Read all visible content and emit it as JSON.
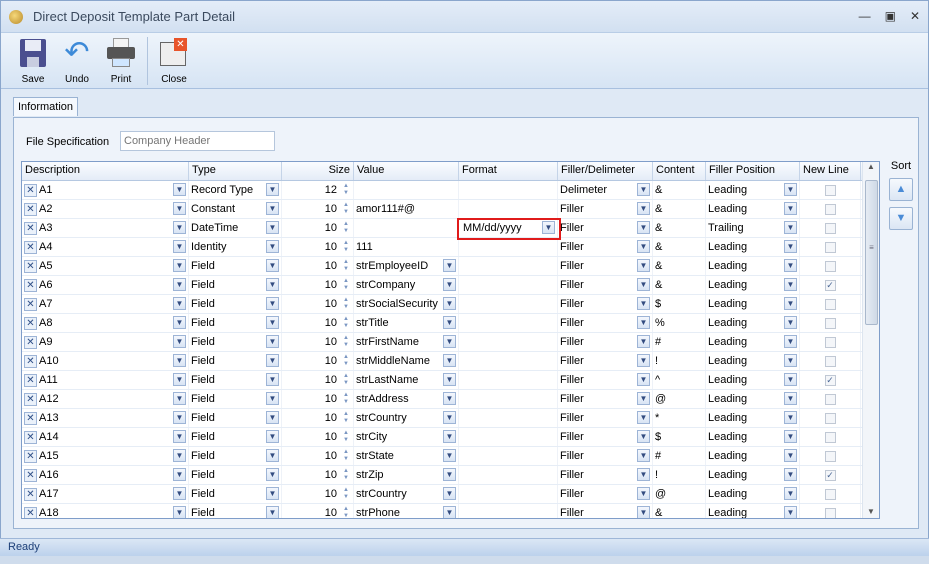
{
  "window": {
    "title": "Direct Deposit Template Part Detail"
  },
  "toolbar": {
    "save": "Save",
    "undo": "Undo",
    "print": "Print",
    "close": "Close"
  },
  "tabs": [
    {
      "label": "Information",
      "active": true
    }
  ],
  "file_spec": {
    "label": "File Specification",
    "placeholder": "Company Header"
  },
  "grid": {
    "columns": [
      "Description",
      "Type",
      "Size",
      "Value",
      "Format",
      "Filler/Delimeter",
      "Content",
      "Filler Position",
      "New Line"
    ],
    "rows": [
      {
        "desc": "A1",
        "type": "Record Type",
        "size": "12",
        "value": "",
        "format": "",
        "filler": "Delimeter",
        "content": "&",
        "pos": "Leading",
        "newline": false
      },
      {
        "desc": "A2",
        "type": "Constant",
        "size": "10",
        "value": "amor111#@",
        "format": "",
        "filler": "Filler",
        "content": "&",
        "pos": "Leading",
        "newline": false
      },
      {
        "desc": "A3",
        "type": "DateTime",
        "size": "10",
        "value": "",
        "format": "MM/dd/yyyy",
        "filler": "Filler",
        "content": "&",
        "pos": "Trailing",
        "newline": false
      },
      {
        "desc": "A4",
        "type": "Identity",
        "size": "10",
        "value": "111",
        "format": "",
        "filler": "Filler",
        "content": "&",
        "pos": "Leading",
        "newline": false
      },
      {
        "desc": "A5",
        "type": "Field",
        "size": "10",
        "value": "strEmployeeID",
        "format": "",
        "filler": "Filler",
        "content": "&",
        "pos": "Leading",
        "newline": false
      },
      {
        "desc": "A6",
        "type": "Field",
        "size": "10",
        "value": "strCompany",
        "format": "",
        "filler": "Filler",
        "content": "&",
        "pos": "Leading",
        "newline": true
      },
      {
        "desc": "A7",
        "type": "Field",
        "size": "10",
        "value": "strSocialSecurity",
        "format": "",
        "filler": "Filler",
        "content": "$",
        "pos": "Leading",
        "newline": false
      },
      {
        "desc": "A8",
        "type": "Field",
        "size": "10",
        "value": "strTitle",
        "format": "",
        "filler": "Filler",
        "content": "%",
        "pos": "Leading",
        "newline": false
      },
      {
        "desc": "A9",
        "type": "Field",
        "size": "10",
        "value": "strFirstName",
        "format": "",
        "filler": "Filler",
        "content": "#",
        "pos": "Leading",
        "newline": false
      },
      {
        "desc": "A10",
        "type": "Field",
        "size": "10",
        "value": "strMiddleName",
        "format": "",
        "filler": "Filler",
        "content": "!",
        "pos": "Leading",
        "newline": false
      },
      {
        "desc": "A11",
        "type": "Field",
        "size": "10",
        "value": "strLastName",
        "format": "",
        "filler": "Filler",
        "content": "^",
        "pos": "Leading",
        "newline": true
      },
      {
        "desc": "A12",
        "type": "Field",
        "size": "10",
        "value": "strAddress",
        "format": "",
        "filler": "Filler",
        "content": "@",
        "pos": "Leading",
        "newline": false
      },
      {
        "desc": "A13",
        "type": "Field",
        "size": "10",
        "value": "strCountry",
        "format": "",
        "filler": "Filler",
        "content": "*",
        "pos": "Leading",
        "newline": false
      },
      {
        "desc": "A14",
        "type": "Field",
        "size": "10",
        "value": "strCity",
        "format": "",
        "filler": "Filler",
        "content": "$",
        "pos": "Leading",
        "newline": false
      },
      {
        "desc": "A15",
        "type": "Field",
        "size": "10",
        "value": "strState",
        "format": "",
        "filler": "Filler",
        "content": "#",
        "pos": "Leading",
        "newline": false
      },
      {
        "desc": "A16",
        "type": "Field",
        "size": "10",
        "value": "strZip",
        "format": "",
        "filler": "Filler",
        "content": "!",
        "pos": "Leading",
        "newline": true
      },
      {
        "desc": "A17",
        "type": "Field",
        "size": "10",
        "value": "strCountry",
        "format": "",
        "filler": "Filler",
        "content": "@",
        "pos": "Leading",
        "newline": false
      },
      {
        "desc": "A18",
        "type": "Field",
        "size": "10",
        "value": "strPhone",
        "format": "",
        "filler": "Filler",
        "content": "&",
        "pos": "Leading",
        "newline": false
      }
    ]
  },
  "sort": {
    "label": "Sort"
  },
  "status": {
    "text": "Ready"
  },
  "colors": {
    "highlight": "#e01b1b",
    "accent": "#4a8bd6"
  }
}
